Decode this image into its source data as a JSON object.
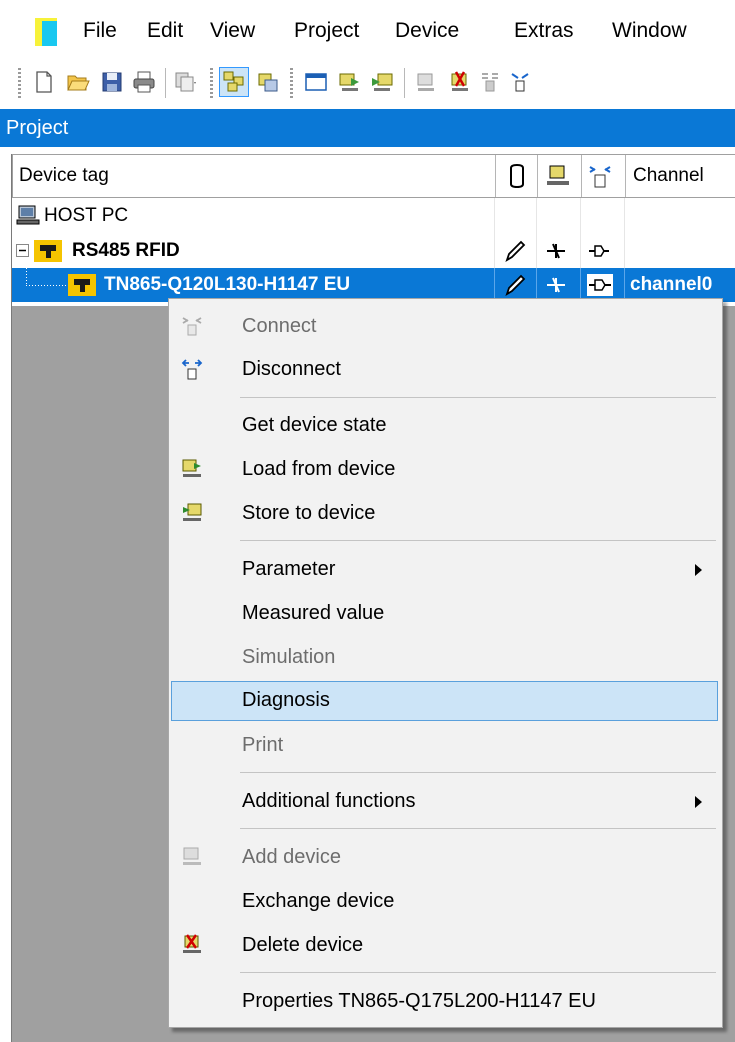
{
  "menubar": {
    "items": [
      "File",
      "Edit",
      "View",
      "Project",
      "Device",
      "Extras",
      "Window"
    ]
  },
  "toolbar": {
    "buttons": [
      "new-icon",
      "open-icon",
      "save-icon",
      "print-icon",
      "copy-dropdown-icon",
      "network-view-icon",
      "device-catalog-icon",
      "window-icon",
      "load-icon",
      "store-icon",
      "add-device-icon",
      "delete-device-icon",
      "connect-icon"
    ]
  },
  "project": {
    "title": "Project"
  },
  "grid": {
    "columns": {
      "device_tag": "Device tag",
      "channel": "Channel"
    },
    "rows": [
      {
        "tag": "HOST PC",
        "channel": ""
      },
      {
        "tag": "RS485 RFID",
        "channel": ""
      },
      {
        "tag": "TN865-Q120L130-H1147 EU",
        "channel": "channel0"
      }
    ]
  },
  "context_menu": {
    "items": [
      {
        "label": "Connect",
        "enabled": false,
        "icon": "connect-icon"
      },
      {
        "label": "Disconnect",
        "enabled": true,
        "icon": "disconnect-icon"
      },
      {
        "label": "Get device state",
        "enabled": true
      },
      {
        "label": "Load from device",
        "enabled": true,
        "icon": "load-from-device-icon"
      },
      {
        "label": "Store to device",
        "enabled": true,
        "icon": "store-to-device-icon"
      },
      {
        "label": "Parameter",
        "enabled": true,
        "submenu": true
      },
      {
        "label": "Measured value",
        "enabled": true
      },
      {
        "label": "Simulation",
        "enabled": false
      },
      {
        "label": "Diagnosis",
        "enabled": true,
        "highlighted": true
      },
      {
        "label": "Print",
        "enabled": false
      },
      {
        "label": "Additional functions",
        "enabled": true,
        "submenu": true
      },
      {
        "label": "Add device",
        "enabled": false,
        "icon": "add-device-icon"
      },
      {
        "label": "Exchange device",
        "enabled": true
      },
      {
        "label": "Delete device",
        "enabled": true,
        "icon": "delete-device-icon"
      },
      {
        "label": "Properties TN865-Q175L200-H1147 EU",
        "enabled": true
      }
    ]
  },
  "colors": {
    "accent": "#0a78d6",
    "selection": "#cce4f7",
    "menu_background": "#f2f2f2",
    "workspace_gray": "#a0a0a0"
  }
}
